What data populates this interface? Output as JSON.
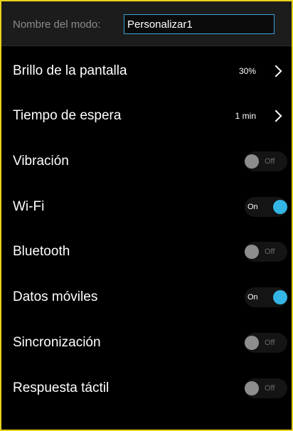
{
  "header": {
    "mode_label": "Nombre del modo:",
    "mode_value": "Personalizar1"
  },
  "colors": {
    "accent": "#33b5e5",
    "frame_border": "#e8d21c",
    "toggle_off": "#8d8d8d"
  },
  "settings": [
    {
      "label": "Brillo de la pantalla",
      "value": "30%",
      "type": "chevron"
    },
    {
      "label": "Tiempo de espera",
      "value": "1 min",
      "type": "chevron"
    },
    {
      "label": "Vibración",
      "state": "Off",
      "type": "toggle",
      "on": false
    },
    {
      "label": "Wi-Fi",
      "state": "On",
      "type": "toggle",
      "on": true
    },
    {
      "label": "Bluetooth",
      "state": "Off",
      "type": "toggle",
      "on": false
    },
    {
      "label": "Datos móviles",
      "state": "On",
      "type": "toggle",
      "on": true
    },
    {
      "label": "Sincronización",
      "state": "Off",
      "type": "toggle",
      "on": false
    },
    {
      "label": "Respuesta táctil",
      "state": "Off",
      "type": "toggle",
      "on": false
    }
  ]
}
